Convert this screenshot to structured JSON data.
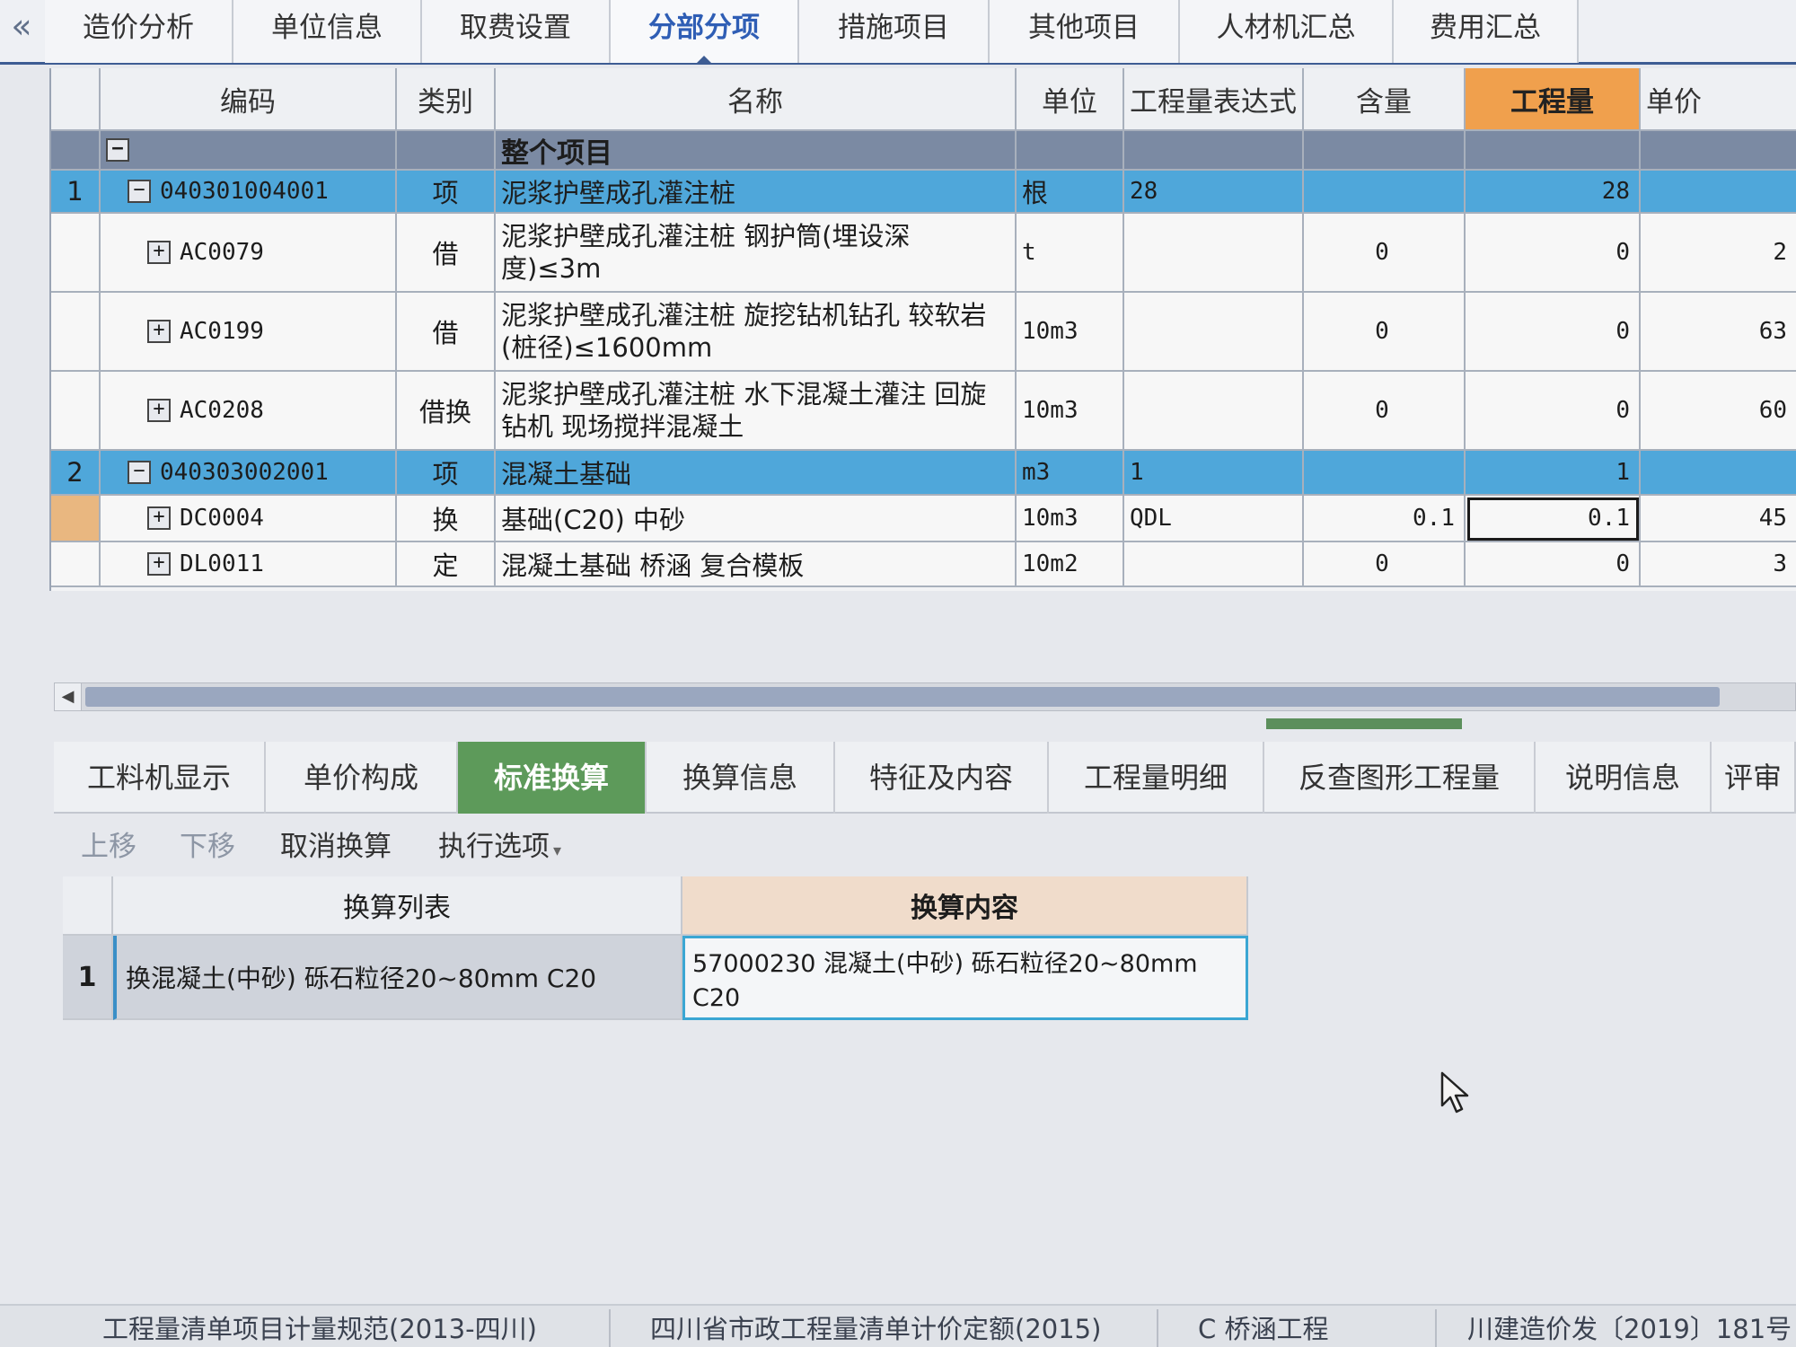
{
  "top_tabs": {
    "collapse_icon": "double-chevron-left-icon",
    "items": [
      "造价分析",
      "单位信息",
      "取费设置",
      "分部分项",
      "措施项目",
      "其他项目",
      "人材机汇总",
      "费用汇总"
    ],
    "active": "分部分项"
  },
  "grid": {
    "columns": [
      "编码",
      "类别",
      "名称",
      "单位",
      "工程量表达式",
      "含量",
      "工程量",
      "单价"
    ],
    "highlighted_column": "工程量",
    "group_row": {
      "name": "整个项目"
    },
    "rows": [
      {
        "seq": "1",
        "code": "040301004001",
        "type": "项",
        "name": "泥浆护壁成孔灌注桩",
        "unit": "根",
        "expr": "28",
        "content": "",
        "qty": "28",
        "price": "",
        "level": "parent"
      },
      {
        "seq": "",
        "code": "AC0079",
        "type": "借",
        "name": "泥浆护壁成孔灌注桩 钢护筒(埋设深度)≤3m",
        "unit": "t",
        "expr": "",
        "content": "0",
        "qty": "0",
        "price": "2",
        "level": "child"
      },
      {
        "seq": "",
        "code": "AC0199",
        "type": "借",
        "name": "泥浆护壁成孔灌注桩 旋挖钻机钻孔 较软岩(桩径)≤1600mm",
        "unit": "10m3",
        "expr": "",
        "content": "0",
        "qty": "0",
        "price": "63",
        "level": "child"
      },
      {
        "seq": "",
        "code": "AC0208",
        "type": "借换",
        "name": "泥浆护壁成孔灌注桩 水下混凝土灌注 回旋钻机 现场搅拌混凝土",
        "unit": "10m3",
        "expr": "",
        "content": "0",
        "qty": "0",
        "price": "60",
        "level": "child"
      },
      {
        "seq": "2",
        "code": "040303002001",
        "type": "项",
        "name": "混凝土基础",
        "unit": "m3",
        "expr": "1",
        "content": "",
        "qty": "1",
        "price": "",
        "level": "parent"
      },
      {
        "seq": "",
        "code": "DC0004",
        "type": "换",
        "name": "基础(C20) 中砂",
        "unit": "10m3",
        "expr": "QDL",
        "content": "0.1",
        "qty": "0.1",
        "price": "45",
        "level": "child"
      },
      {
        "seq": "",
        "code": "DL0011",
        "type": "定",
        "name": "混凝土基础 桥涵 复合模板",
        "unit": "10m2",
        "expr": "",
        "content": "0",
        "qty": "0",
        "price": "3",
        "level": "child"
      }
    ]
  },
  "bottom_tabs": {
    "items": [
      "工料机显示",
      "单价构成",
      "标准换算",
      "换算信息",
      "特征及内容",
      "工程量明细",
      "反查图形工程量",
      "说明信息",
      "评审"
    ],
    "active": "标准换算"
  },
  "toolbar": {
    "move_up": "上移",
    "move_down": "下移",
    "cancel_conversion": "取消换算",
    "execute_options": "执行选项"
  },
  "conversion": {
    "col_list": "换算列表",
    "col_content": "换算内容",
    "rows": [
      {
        "seq": "1",
        "list": "换混凝土(中砂) 砾石粒径20~80mm C20",
        "content": "57000230 混凝土(中砂) 砾石粒径20~80mm C20"
      }
    ]
  },
  "status_bar": [
    "工程量清单项目计量规范(2013-四川)",
    "四川省市政工程量清单计价定额(2015)",
    "C 桥涵工程",
    "川建造价发〔2019〕181号"
  ]
}
